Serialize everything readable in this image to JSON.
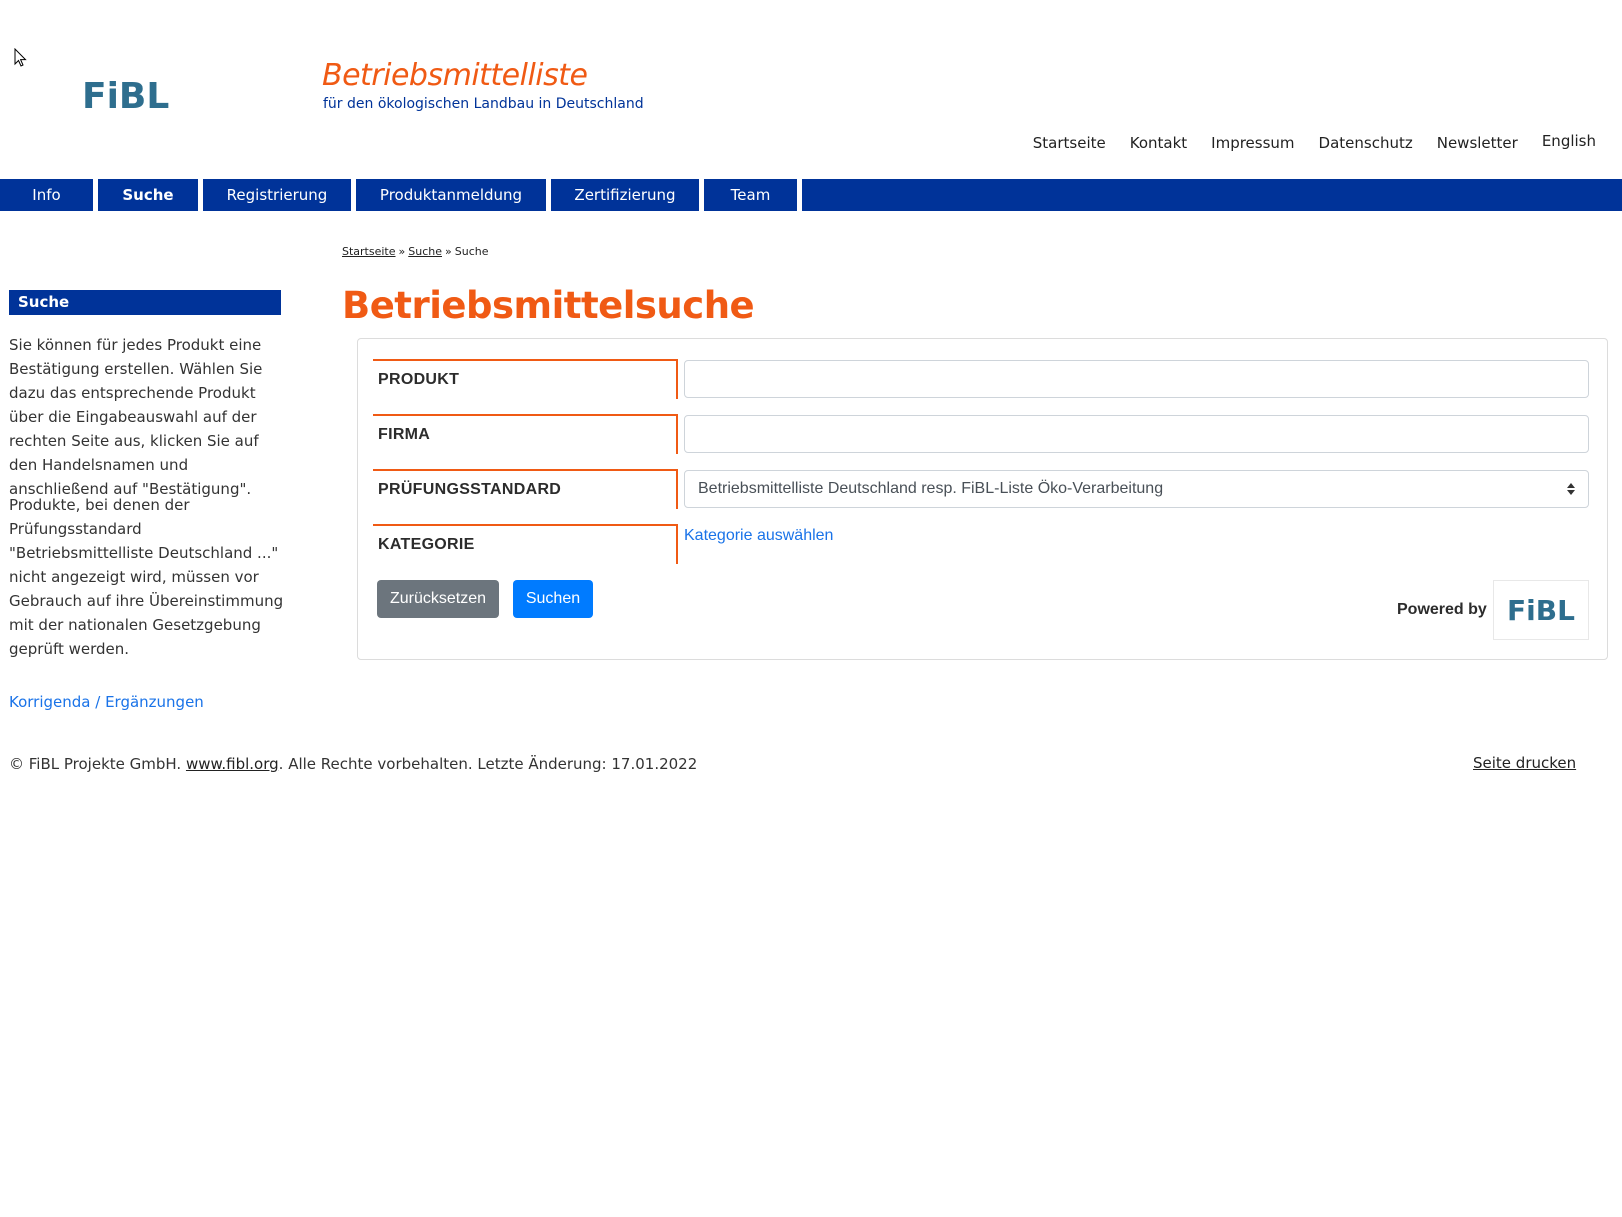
{
  "header": {
    "logo_text": "FiBL",
    "site_title": "Betriebsmittelliste",
    "site_subtitle": "für den ökologischen Landbau in Deutschland",
    "top_links": [
      {
        "label": "Startseite"
      },
      {
        "label": "Kontakt"
      },
      {
        "label": "Impressum"
      },
      {
        "label": "Datenschutz"
      },
      {
        "label": "Newsletter"
      },
      {
        "label": "English"
      }
    ]
  },
  "nav": {
    "items": [
      {
        "label": "Info",
        "active": false
      },
      {
        "label": "Suche",
        "active": true
      },
      {
        "label": "Registrierung",
        "active": false
      },
      {
        "label": "Produktanmeldung",
        "active": false
      },
      {
        "label": "Zertifizierung",
        "active": false
      },
      {
        "label": "Team",
        "active": false
      }
    ]
  },
  "breadcrumb": {
    "items": [
      {
        "label": "Startseite",
        "link": true
      },
      {
        "label": "Suche",
        "link": true
      },
      {
        "label": "Suche",
        "link": false
      }
    ],
    "separator": "»"
  },
  "page_title": "Betriebsmittelsuche",
  "sidebar": {
    "heading": "Suche",
    "paragraph1": "Sie können für jedes Produkt eine Bestätigung erstellen. Wählen Sie dazu das entsprechende Produkt über die Eingabeauswahl auf der rechten Seite aus, klicken Sie auf den Handelsnamen und anschließend auf \"Bestätigung\".",
    "paragraph2": "Produkte, bei denen der Prüfungsstandard \"Betriebsmittelliste Deutschland ...\" nicht angezeigt wird, müssen vor Gebrauch auf ihre Übereinstimmung mit der nationalen Gesetzgebung geprüft werden.",
    "korrigenda_link": "Korrigenda / Ergänzungen"
  },
  "form": {
    "fields": {
      "produkt": {
        "label": "PRODUKT",
        "value": "",
        "placeholder": ""
      },
      "firma": {
        "label": "FIRMA",
        "value": "",
        "placeholder": ""
      },
      "pruefungsstandard": {
        "label": "PRÜFUNGSSTANDARD",
        "selected": "Betriebsmittelliste Deutschland resp. FiBL-Liste Öko-Verarbeitung"
      },
      "kategorie": {
        "label": "KATEGORIE",
        "link_label": "Kategorie auswählen"
      }
    },
    "reset_label": "Zurücksetzen",
    "search_label": "Suchen",
    "powered_by": "Powered by",
    "powered_logo": "FiBL"
  },
  "footer": {
    "copyright_prefix": "© FiBL Projekte GmbH. ",
    "site_link": "www.fibl.org",
    "copyright_suffix": ". Alle Rechte vorbehalten. Letzte Änderung: 17.01.2022",
    "print_link": "Seite drucken"
  },
  "colors": {
    "brand_blue": "#003399",
    "accent_orange": "#f05a14",
    "logo_teal": "#2e6e8e",
    "link_blue": "#1a73e8",
    "btn_primary": "#007bff",
    "btn_secondary": "#6c757d"
  }
}
